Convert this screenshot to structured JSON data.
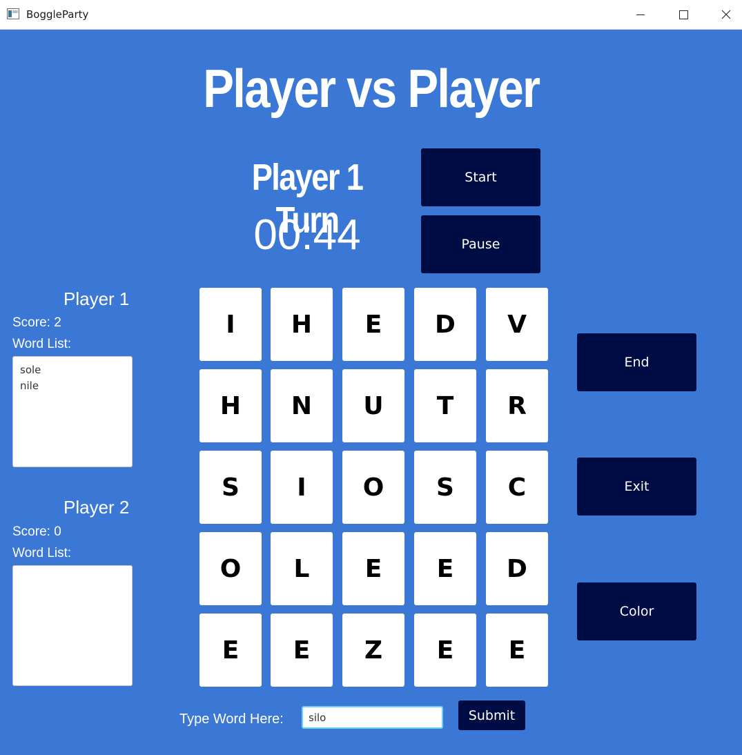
{
  "window": {
    "title": "BoggleParty"
  },
  "header": {
    "title": "Player vs Player"
  },
  "turn": {
    "label": "Player 1 Turn",
    "timer": "00:44"
  },
  "controls": {
    "start": "Start",
    "pause": "Pause",
    "end": "End",
    "exit": "Exit",
    "color": "Color"
  },
  "players": [
    {
      "name": "Player 1",
      "score": "Score: 2",
      "word_list_label": "Word List:",
      "words": [
        "sole",
        "nile"
      ]
    },
    {
      "name": "Player 2",
      "score": "Score: 0",
      "word_list_label": "Word List:",
      "words": []
    }
  ],
  "board": [
    [
      "I",
      "H",
      "E",
      "D",
      "V"
    ],
    [
      "H",
      "N",
      "U",
      "T",
      "R"
    ],
    [
      "S",
      "I",
      "O",
      "S",
      "C"
    ],
    [
      "O",
      "L",
      "E",
      "E",
      "D"
    ],
    [
      "E",
      "E",
      "Z",
      "E",
      "E"
    ]
  ],
  "entry": {
    "label": "Type Word Here:",
    "value": "silo",
    "submit": "Submit"
  },
  "colors": {
    "background": "#3b78d6",
    "button": "#000d45",
    "tile": "#ffffff",
    "input_border": "#6dd0f5"
  }
}
